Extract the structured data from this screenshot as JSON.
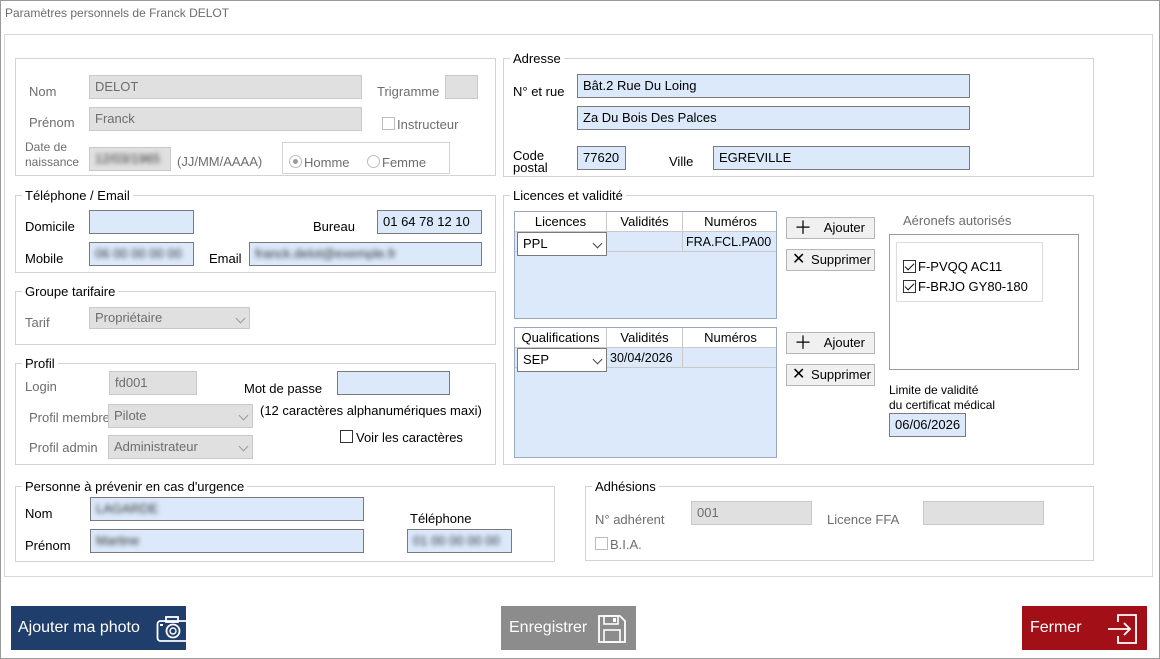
{
  "window": {
    "title": "Paramètres personnels de Franck DELOT"
  },
  "identity": {
    "nom_label": "Nom",
    "nom_value": "DELOT",
    "prenom_label": "Prénom",
    "prenom_value": "Franck",
    "trigramme_label": "Trigramme",
    "trigramme_value": "",
    "instructeur_label": "Instructeur",
    "instructeur_checked": false,
    "naissance_label_1": "Date de",
    "naissance_label_2": "naissance",
    "naissance_value": "12/03/1965",
    "naissance_format": "(JJ/MM/AAAA)",
    "gender_male": "Homme",
    "gender_female": "Femme",
    "gender_selected": "Homme"
  },
  "phone": {
    "legend": "Téléphone / Email",
    "domicile_label": "Domicile",
    "domicile_value": "",
    "bureau_label": "Bureau",
    "bureau_value": "01 64 78 12 10",
    "mobile_label": "Mobile",
    "mobile_value": "06 00 00 00 00",
    "email_label": "Email",
    "email_value": "franck.delot@exemple.fr"
  },
  "tarif": {
    "legend": "Groupe tarifaire",
    "label": "Tarif",
    "value": "Propriétaire"
  },
  "profil": {
    "legend": "Profil",
    "login_label": "Login",
    "login_value": "fd001",
    "password_label": "Mot de passe",
    "password_value": "",
    "membre_label": "Profil membre",
    "membre_value": "Pilote",
    "password_hint": "(12 caractères alphanumériques  maxi)",
    "admin_label": "Profil admin",
    "admin_value": "Administrateur",
    "show_chars_label": "Voir les caractères"
  },
  "urgence": {
    "legend": "Personne à prévenir en cas d'urgence",
    "nom_label": "Nom",
    "nom_value": "LAGARDE",
    "prenom_label": "Prénom",
    "prenom_value": "Martine",
    "tel_label": "Téléphone",
    "tel_value": "01 00 00 00 00"
  },
  "adresse": {
    "legend": "Adresse",
    "rue_label": "N° et rue",
    "rue_line1": "Bât.2 Rue Du Loing",
    "rue_line2": "Za Du Bois Des Palces",
    "cp_label_1": "Code",
    "cp_label_2": "postal",
    "cp_value": "77620",
    "ville_label": "Ville",
    "ville_value": "EGREVILLE"
  },
  "licences": {
    "legend": "Licences et validité",
    "lic_headers": [
      "Licences",
      "Validités",
      "Numéros"
    ],
    "lic_row": {
      "type": "PPL",
      "validite": "",
      "numero": "FRA.FCL.PA00"
    },
    "qual_headers": [
      "Qualifications",
      "Validités",
      "Numéros"
    ],
    "qual_row": {
      "type": "SEP",
      "validite": "30/04/2026",
      "numero": ""
    },
    "add_label": "Ajouter",
    "delete_label": "Supprimer",
    "aeronefs_label": "Aéronefs autorisés",
    "aeronefs": [
      {
        "label": "F-PVQQ  AC11",
        "checked": true
      },
      {
        "label": "F-BRJO  GY80-180",
        "checked": true
      }
    ],
    "medical_label_1": "Limite de validité",
    "medical_label_2": "du certificat médical",
    "medical_value": "06/06/2026"
  },
  "adhesions": {
    "legend": "Adhésions",
    "numero_label": "N° adhérent",
    "numero_value": "001",
    "ffa_label": "Licence FFA",
    "ffa_value": "",
    "bia_label": "B.I.A."
  },
  "footer": {
    "photo_label": "Ajouter ma photo",
    "save_label": "Enregistrer",
    "close_label": "Fermer"
  },
  "colors": {
    "photo_bg": "#1f3e6b",
    "save_bg": "#8c8c8c",
    "close_bg": "#a30f16",
    "field_bg": "#dbe9fb",
    "disabled_bg": "#e0e0e0"
  }
}
